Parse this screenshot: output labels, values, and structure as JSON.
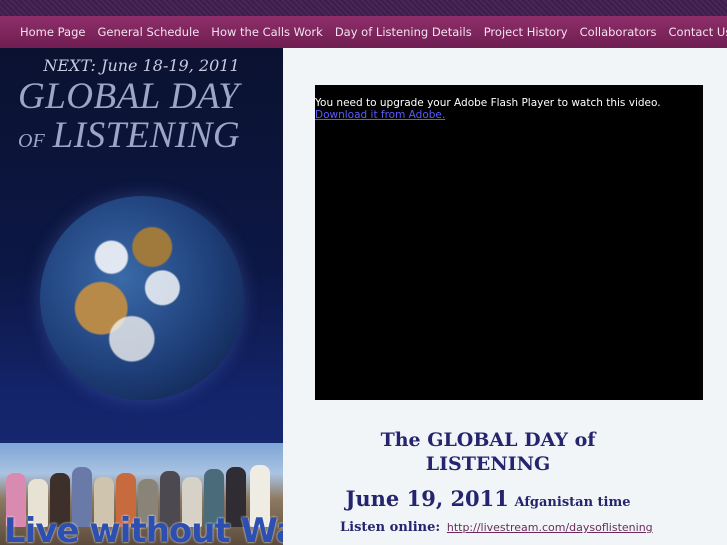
{
  "nav": {
    "items": [
      {
        "label": "Home Page"
      },
      {
        "label": "General Schedule"
      },
      {
        "label": "How the Calls Work"
      },
      {
        "label": "Day of Listening Details"
      },
      {
        "label": "Project History"
      },
      {
        "label": "Collaborators"
      },
      {
        "label": "Contact Us"
      }
    ]
  },
  "banner": {
    "next": "NEXT: June 18-19, 2011",
    "title_line1": "GLOBAL DAY",
    "title_of": "OF",
    "title_line2": "LISTENING"
  },
  "photo": {
    "caption": "Live without Wars"
  },
  "video": {
    "message": "You need to upgrade your Adobe Flash Player to watch this video.",
    "download_link": "Download it from Adobe."
  },
  "event": {
    "title": "The GLOBAL DAY of LISTENING",
    "date": "June 19, 2011",
    "timezone": "Afganistan time",
    "listen_label": "Listen online:",
    "listen_url": "http://livestream.com/daysoflistening"
  },
  "colors": {
    "nav_bg": "#7e2660",
    "heading": "#25246e",
    "link": "#6a2b5a"
  }
}
